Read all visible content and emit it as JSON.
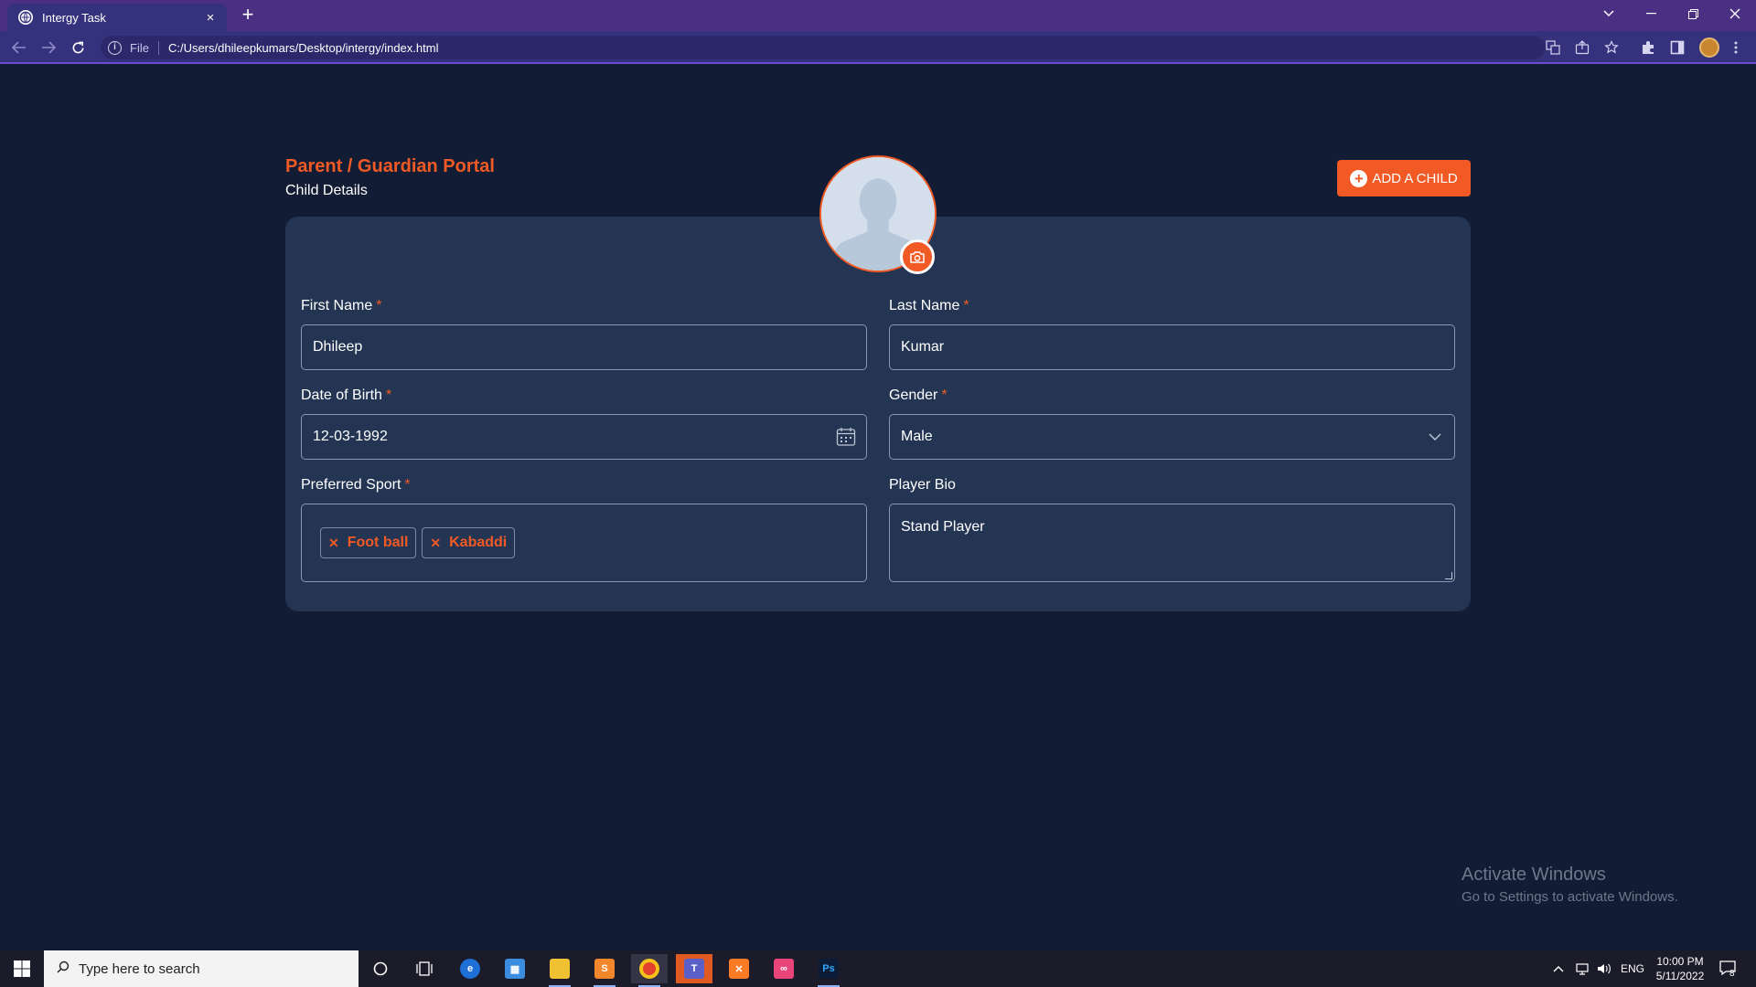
{
  "browser": {
    "tab_title": "Intergy Task",
    "new_tab_label": "+",
    "file_label": "File",
    "url": "C:/Users/dhileepkumars/Desktop/intergy/index.html"
  },
  "header": {
    "portal_title": "Parent / Guardian Portal",
    "subtitle": "Child Details",
    "add_child_label": "ADD A CHILD"
  },
  "form": {
    "first_name": {
      "label": "First Name",
      "required": "*",
      "value": "Dhileep"
    },
    "last_name": {
      "label": "Last Name",
      "required": "*",
      "value": "Kumar"
    },
    "dob": {
      "label": "Date of Birth",
      "required": "*",
      "value": "12-03-1992"
    },
    "gender": {
      "label": "Gender",
      "required": "*",
      "value": "Male"
    },
    "sport": {
      "label": "Preferred Sport",
      "required": "*",
      "tags": [
        "Foot ball",
        "Kabaddi"
      ]
    },
    "bio": {
      "label": "Player Bio",
      "value": "Stand Player"
    }
  },
  "watermark": {
    "line1": "Activate Windows",
    "line2": "Go to Settings to activate Windows."
  },
  "taskbar": {
    "search_placeholder": "Type here to search",
    "language": "ENG",
    "time": "10:00 PM",
    "date": "5/11/2022",
    "notification_count": "8"
  },
  "colors": {
    "accent": "#f15a24",
    "page_bg": "#121d35",
    "card_bg": "#243553",
    "tabbar_bg": "#4a2f82"
  }
}
